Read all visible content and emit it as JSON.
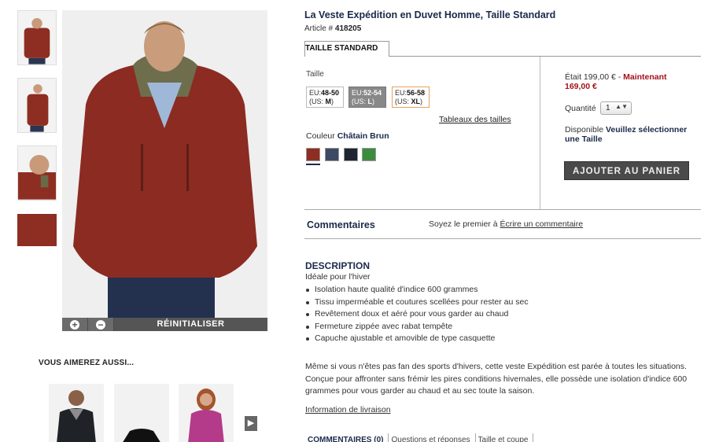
{
  "product": {
    "title": "La Veste Expédition en Duvet Homme, Taille Standard",
    "article_prefix": "Article # ",
    "article_number": "418205",
    "fit_tab": "TAILLE STANDARD"
  },
  "gallery": {
    "zoom_in": "+",
    "zoom_out": "−",
    "reset_label": "RÉINITIALISER"
  },
  "sizes": {
    "label": "Taille",
    "options": [
      {
        "eu_prefix": "EU:",
        "eu": "48-50",
        "us_prefix": "(US: ",
        "us": "M",
        "us_suffix": ")"
      },
      {
        "eu_prefix": "EU:",
        "eu": "52-54",
        "us_prefix": "(US: ",
        "us": "L",
        "us_suffix": ")"
      },
      {
        "eu_prefix": "EU:",
        "eu": "56-58",
        "us_prefix": "(US: ",
        "us": "XL",
        "us_suffix": ")"
      }
    ],
    "selected_index": 1,
    "chart_link": "Tableaux des tailles"
  },
  "color": {
    "label": "Couleur ",
    "selected_name": "Châtain Brun",
    "swatches": [
      "#8e2e22",
      "#3e4a63",
      "#1e2430",
      "#3c8c3e"
    ]
  },
  "pricing": {
    "prev_label": "Était 199,00 € - ",
    "now_label": "Maintenant",
    "now_price": "169,00 €"
  },
  "quantity": {
    "label": "Quantité",
    "value": "1",
    "arrows": "▲▼"
  },
  "availability": {
    "label": "Disponible ",
    "message": "Veuillez sélectionner une Taille"
  },
  "cart": {
    "add_label": "AJOUTER AU PANIER"
  },
  "comments": {
    "title": "Commentaires",
    "cta_prefix": "Soyez le premier à ",
    "cta_link": "Écrire un commentaire"
  },
  "description": {
    "title": "DESCRIPTION",
    "subtitle": "Idéale pour l'hiver",
    "features": [
      "Isolation haute qualité d'indice 600 grammes",
      "Tissu imperméable et coutures scellées pour rester au sec",
      "Revêtement doux et aéré pour vous garder au chaud",
      "Fermeture zippée avec rabat tempête",
      "Capuche ajustable et amovible de type casquette"
    ],
    "paragraph": "Même si vous n'êtes pas fan des sports d'hivers, cette veste Expédition est parée à toutes les situations. Conçue pour affronter sans frémir les pires conditions hivernales, elle possède une isolation d'indice 600 grammes pour vous garder au chaud et au sec toute la saison.",
    "shipping_link": "Information de livraison"
  },
  "also_like": {
    "title": "VOUS AIMEREZ AUSSI...",
    "next_icon": "play-arrow-icon"
  },
  "bottom_tabs": [
    "COMMENTAIRES (0)",
    "Questions et réponses",
    "Taille et coupe"
  ],
  "colors": {
    "accent_red": "#a2121c",
    "navy": "#1a2a4a",
    "button_dark": "#4a4a4a"
  }
}
